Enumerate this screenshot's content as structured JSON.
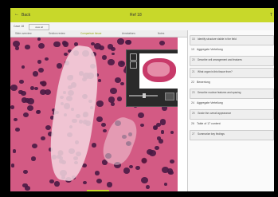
{
  "topbar": {
    "back_icon": "←",
    "back_label": "Back",
    "title": "Ref 18",
    "right": "T"
  },
  "crumbs": {
    "left": "Case 18",
    "pill": "view all"
  },
  "tabs": [
    "Slide overview",
    "Section review",
    "Comparison tissue",
    "Annotations",
    "Notes"
  ],
  "panel": {
    "items": [
      {
        "kind": "q",
        "num": "18",
        "text": "Identify structure visible in the field"
      },
      {
        "kind": "sec",
        "num": "19",
        "text": "Aggregate Verteilung"
      },
      {
        "kind": "q",
        "num": "20",
        "text": "Describe cell arrangement and features"
      },
      {
        "kind": "q",
        "num": "21",
        "text": "What organ is this tissue from?"
      },
      {
        "kind": "sec",
        "num": "22",
        "text": "Bewertung"
      },
      {
        "kind": "q",
        "num": "23",
        "text": "Describe nuclear features and spacing"
      },
      {
        "kind": "sec",
        "num": "24",
        "text": "Aggregate Verteilung"
      },
      {
        "kind": "q",
        "num": "25",
        "text": "Grade the overall appearance"
      },
      {
        "kind": "sec",
        "num": "26",
        "text": "Table of 17 content"
      },
      {
        "kind": "q",
        "num": "27",
        "text": "Summarize key findings"
      }
    ]
  }
}
